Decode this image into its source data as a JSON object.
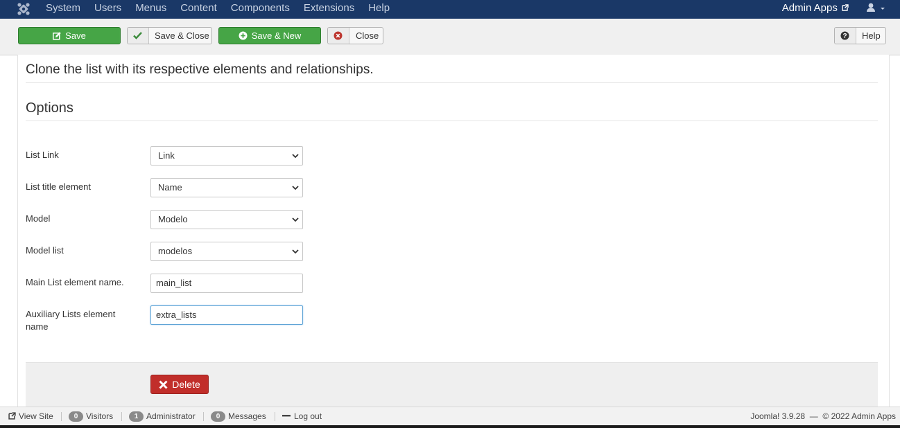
{
  "topbar": {
    "menu": [
      "System",
      "Users",
      "Menus",
      "Content",
      "Components",
      "Extensions",
      "Help"
    ],
    "site_name": "Admin Apps",
    "logo_icon": "joomla-logo-icon",
    "user_icon": "user-icon"
  },
  "toolbar": {
    "save": "Save",
    "save_close": "Save & Close",
    "save_new": "Save & New",
    "close": "Close",
    "help": "Help"
  },
  "content": {
    "description": "Clone the list with its respective elements and relationships.",
    "options_title": "Options"
  },
  "form": {
    "list_link": {
      "label": "List Link",
      "value": "Link"
    },
    "list_title_element": {
      "label": "List title element",
      "value": "Name"
    },
    "model": {
      "label": "Model",
      "value": "Modelo"
    },
    "model_list": {
      "label": "Model list",
      "value": "modelos"
    },
    "main_list_name": {
      "label": "Main List element name.",
      "value": "main_list"
    },
    "aux_lists_name": {
      "label": "Auxiliary Lists element name",
      "value": "extra_lists"
    }
  },
  "actions": {
    "delete": "Delete"
  },
  "statusbar": {
    "view_site": "View Site",
    "visitors_count": "0",
    "visitors_label": "Visitors",
    "admin_count": "1",
    "admin_label": "Administrator",
    "messages_count": "0",
    "messages_label": "Messages",
    "logout": "Log out",
    "version": "Joomla! 3.9.28",
    "copyright": "© 2022 Admin Apps"
  },
  "colors": {
    "navbar": "#1a3867",
    "green_button": "#46a546",
    "delete_button": "#c12e2a"
  }
}
